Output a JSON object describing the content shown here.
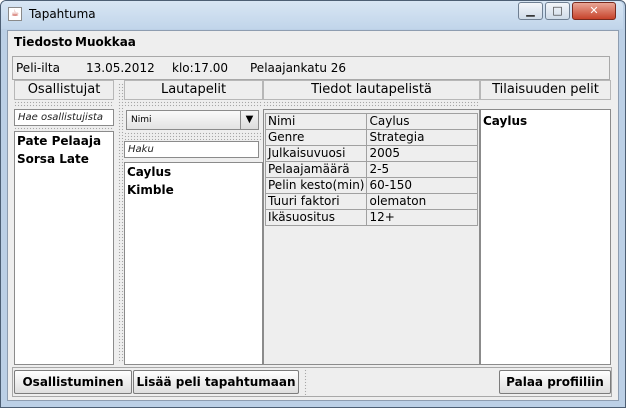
{
  "window": {
    "title": "Tapahtuma",
    "min_glyph": "▁",
    "max_glyph": "□",
    "close_glyph": "✕"
  },
  "menu": [
    "Tiedosto",
    "Muokkaa"
  ],
  "info": {
    "type": "Peli-ilta",
    "date": "13.05.2012",
    "time": "klo:17.00",
    "place": "Pelaajankatu 26"
  },
  "headers": {
    "participants": "Osallistujat",
    "games": "Lautapelit",
    "details": "Tiedot lautapelistä",
    "venue_games": "Tilaisuuden pelit"
  },
  "participants": {
    "placeholder": "Hae osallistujista",
    "items": [
      "Pate Pelaaja",
      "Sorsa Late"
    ]
  },
  "games": {
    "sort_value": "Nimi",
    "search_placeholder": "Haku",
    "items": [
      "Caylus",
      "Kimble"
    ]
  },
  "details": {
    "rows": [
      [
        "Nimi",
        "Caylus"
      ],
      [
        "Genre",
        "Strategia"
      ],
      [
        "Julkaisuvuosi",
        "2005"
      ],
      [
        "Pelaajamäärä",
        "2-5"
      ],
      [
        "Pelin kesto(min)",
        "60-150"
      ],
      [
        "Tuuri faktori",
        "olematon"
      ],
      [
        "Ikäsuositus",
        "12+"
      ]
    ]
  },
  "venue_games": {
    "items": [
      "Caylus"
    ]
  },
  "buttons": {
    "participate": "Osallistuminen",
    "add_game": "Lisää peli tapahtumaan",
    "back": "Palaa profiiliin"
  }
}
